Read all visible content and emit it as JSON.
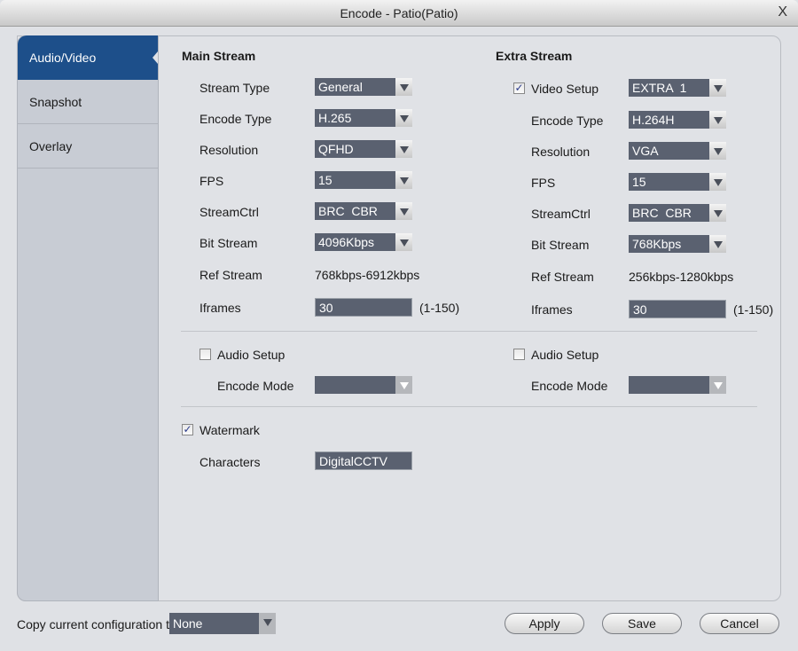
{
  "window": {
    "title": "Encode  - Patio(Patio)",
    "close_glyph": "X"
  },
  "sidebar": {
    "items": [
      {
        "label": "Audio/Video",
        "active": true
      },
      {
        "label": "Snapshot",
        "active": false
      },
      {
        "label": "Overlay",
        "active": false
      }
    ]
  },
  "main": {
    "heading": "Main Stream",
    "stream_type": {
      "label": "Stream Type",
      "value": "General"
    },
    "encode_type": {
      "label": "Encode Type",
      "value": "H.265"
    },
    "resolution": {
      "label": "Resolution",
      "value": "QFHD"
    },
    "fps": {
      "label": "FPS",
      "value": "15"
    },
    "stream_ctrl": {
      "label": "StreamCtrl",
      "value": "BRC  CBR"
    },
    "bit_stream": {
      "label": "Bit Stream",
      "value": "4096Kbps"
    },
    "ref_stream": {
      "label": "Ref Stream",
      "value": "768kbps-6912kbps"
    },
    "iframes": {
      "label": "Iframes",
      "value": "30",
      "range": "(1-150)"
    },
    "audio": {
      "label": "Audio Setup",
      "checked": false,
      "encode_mode_label": "Encode Mode",
      "encode_mode_value": ""
    }
  },
  "extra": {
    "heading": "Extra Stream",
    "video_setup": {
      "label": "Video Setup",
      "checked": true,
      "value": "EXTRA  1"
    },
    "encode_type": {
      "label": "Encode Type",
      "value": "H.264H"
    },
    "resolution": {
      "label": "Resolution",
      "value": "VGA"
    },
    "fps": {
      "label": "FPS",
      "value": "15"
    },
    "stream_ctrl": {
      "label": "StreamCtrl",
      "value": "BRC  CBR"
    },
    "bit_stream": {
      "label": "Bit Stream",
      "value": "768Kbps"
    },
    "ref_stream": {
      "label": "Ref Stream",
      "value": "256kbps-1280kbps"
    },
    "iframes": {
      "label": "Iframes",
      "value": "30",
      "range": "(1-150)"
    },
    "audio": {
      "label": "Audio Setup",
      "checked": false,
      "encode_mode_label": "Encode Mode",
      "encode_mode_value": ""
    }
  },
  "watermark": {
    "label": "Watermark",
    "checked": true,
    "characters_label": "Characters",
    "characters_value": "DigitalCCTV"
  },
  "footer": {
    "copy_label": "Copy current configuration to",
    "copy_value": "None",
    "apply": "Apply",
    "save": "Save",
    "cancel": "Cancel"
  },
  "check_glyph": "✓"
}
